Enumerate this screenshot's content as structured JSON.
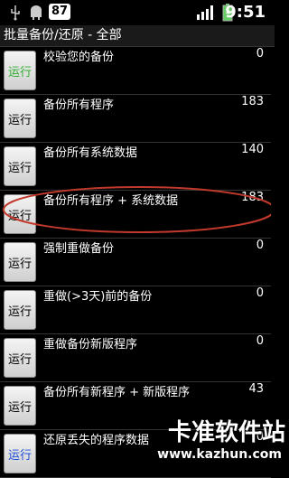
{
  "status_bar": {
    "battery_level": "87",
    "time": "9:51",
    "icons": [
      "usb-icon",
      "android-icon",
      "signal-icon",
      "battery-icon"
    ]
  },
  "title": "批量备份/还原 - 全部",
  "rows": [
    {
      "button": "运行",
      "label": "校验您的备份",
      "count": "0"
    },
    {
      "button": "运行",
      "label": "备份所有程序",
      "count": "183"
    },
    {
      "button": "运行",
      "label": "备份所有系统数据",
      "count": "140"
    },
    {
      "button": "运行",
      "label": "备份所有程序 + 系统数据",
      "count": "183"
    },
    {
      "button": "运行",
      "label": "强制重做备份",
      "count": "0"
    },
    {
      "button": "运行",
      "label": "重做(>3天)前的备份",
      "count": "0"
    },
    {
      "button": "运行",
      "label": "重做备份新版程序",
      "count": "0"
    },
    {
      "button": "运行",
      "label": "备份所有新程序 + 新版程序",
      "count": "43"
    },
    {
      "button": "运行",
      "label": "还原丢失的程序数据",
      "count": "0"
    }
  ],
  "watermark": {
    "brand": "卡准软件站",
    "url": "www.kazhun.com"
  },
  "colors": {
    "highlight_ellipse": "#c0392b",
    "first_button_text": "#2fae2f",
    "last_button_text": "#1d4ed8"
  }
}
